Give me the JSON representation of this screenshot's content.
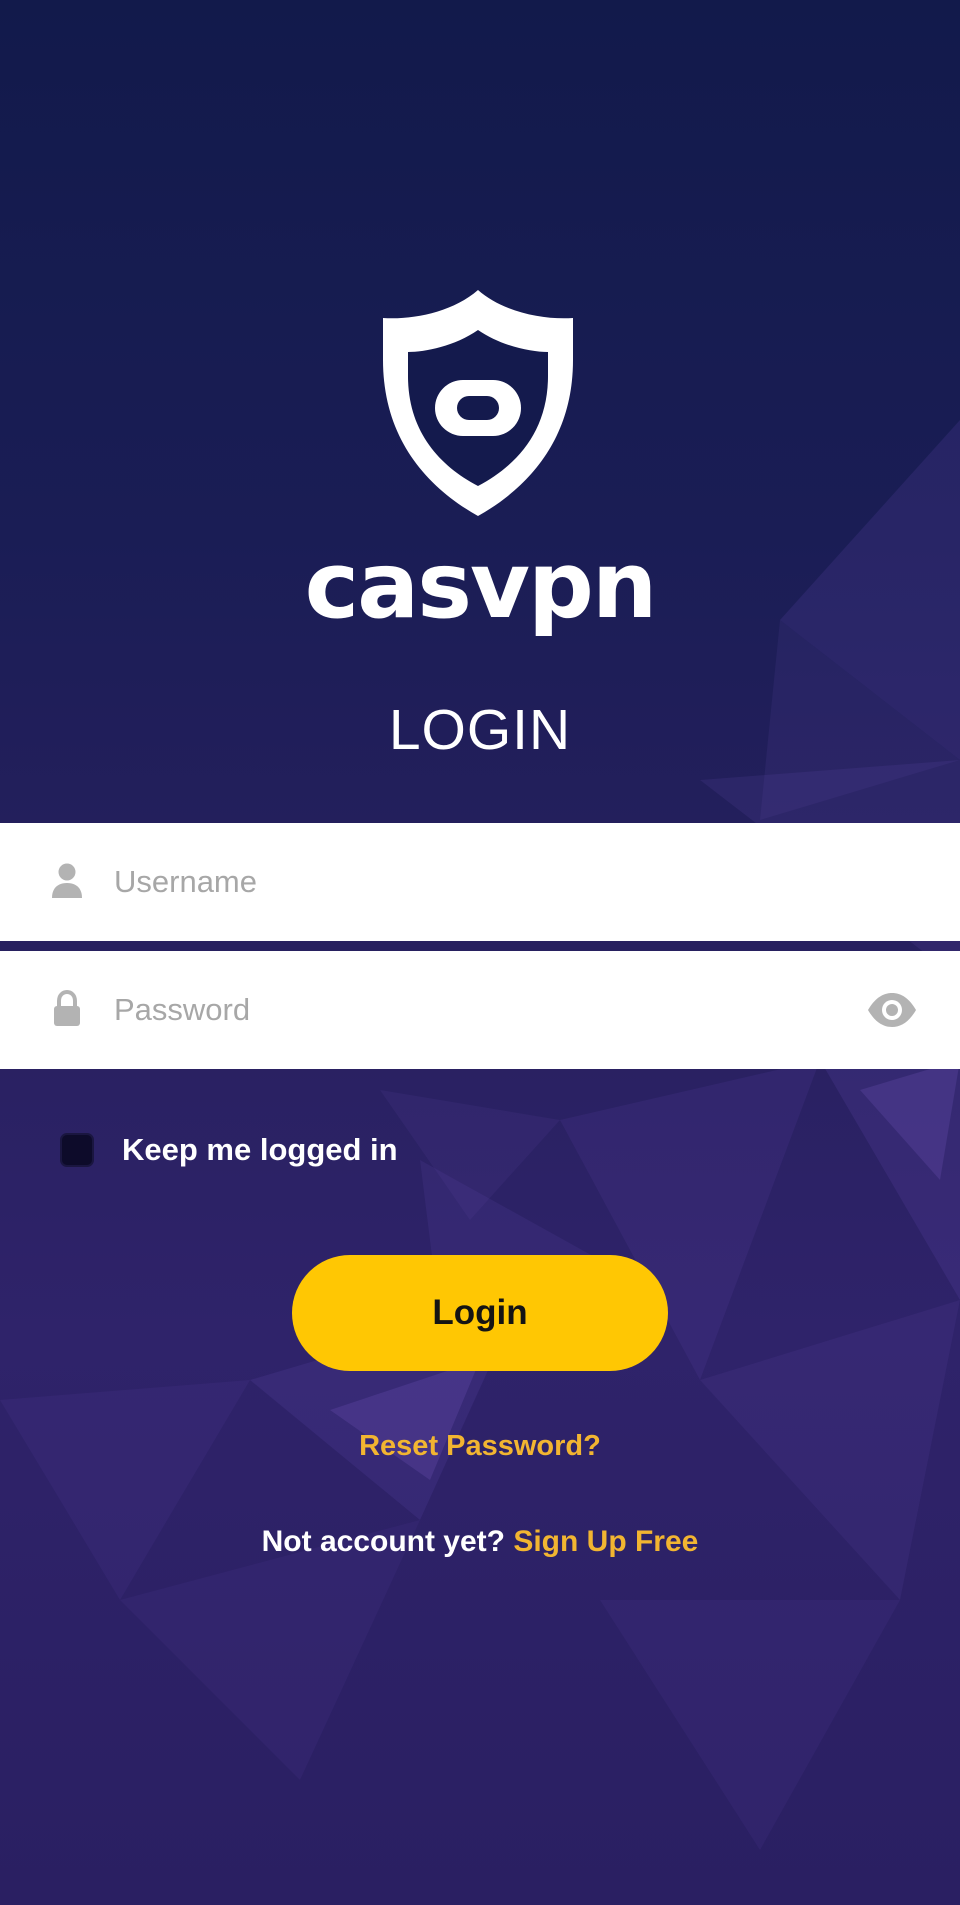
{
  "brand": {
    "name": "casvpn",
    "logo_icon": "shield-icon"
  },
  "login_screen": {
    "title": "LOGIN",
    "username": {
      "placeholder": "Username",
      "value": "",
      "icon": "user-icon"
    },
    "password": {
      "placeholder": "Password",
      "value": "",
      "icon": "lock-icon",
      "toggle_icon": "eye-icon"
    },
    "keep_logged_in": {
      "label": "Keep me logged in",
      "checked": false
    },
    "login_button": "Login",
    "reset_password": "Reset Password?",
    "signup": {
      "prompt": "Not account yet?",
      "link": "Sign Up Free"
    }
  },
  "colors": {
    "background_top": "#121a4b",
    "background_bottom": "#2f236a",
    "accent": "#ffc703",
    "link": "#f2b531",
    "field_bg": "#ffffff",
    "placeholder": "#a7a7a7"
  }
}
